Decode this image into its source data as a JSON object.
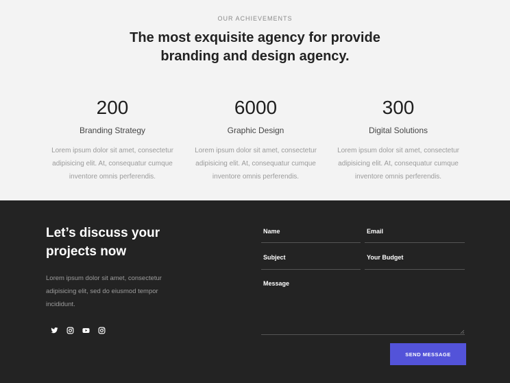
{
  "achievements": {
    "eyebrow": "OUR ACHIEVEMENTS",
    "headline_line1": "The most exquisite agency for provide",
    "headline_line2": "branding and design agency.",
    "stats": [
      {
        "number": "200",
        "title": "Branding Strategy",
        "desc_line1": "Lorem ipsum dolor sit amet, consectetur",
        "desc_line2": "adipisicing elit. At, consequatur cumque",
        "desc_line3": "inventore omnis perferendis."
      },
      {
        "number": "6000",
        "title": "Graphic Design",
        "desc_line1": "Lorem ipsum dolor sit amet, consectetur",
        "desc_line2": "adipisicing elit. At, consequatur cumque",
        "desc_line3": "inventore omnis perferendis."
      },
      {
        "number": "300",
        "title": "Digital Solutions",
        "desc_line1": "Lorem ipsum dolor sit amet, consectetur",
        "desc_line2": "adipisicing elit. At, consequatur cumque",
        "desc_line3": "inventore omnis perferendis."
      }
    ]
  },
  "contact": {
    "title_line1": "Let’s discuss your",
    "title_line2": "projects now",
    "desc_line1": "Lorem ipsum dolor sit amet, consectetur",
    "desc_line2": "adipisicing elit, sed do eiusmod tempor",
    "desc_line3": "incididunt.",
    "socials": [
      "twitter-icon",
      "instagram-icon",
      "youtube-icon",
      "instagram-icon"
    ],
    "form": {
      "name_label": "Name",
      "email_label": "Email",
      "subject_label": "Subject",
      "budget_label": "Your Budget",
      "message_label": "Message",
      "send_label": "SEND MESSAGE"
    }
  },
  "colors": {
    "light_bg": "#f3f3f3",
    "dark_bg": "#232323",
    "accent": "#5353d9"
  }
}
